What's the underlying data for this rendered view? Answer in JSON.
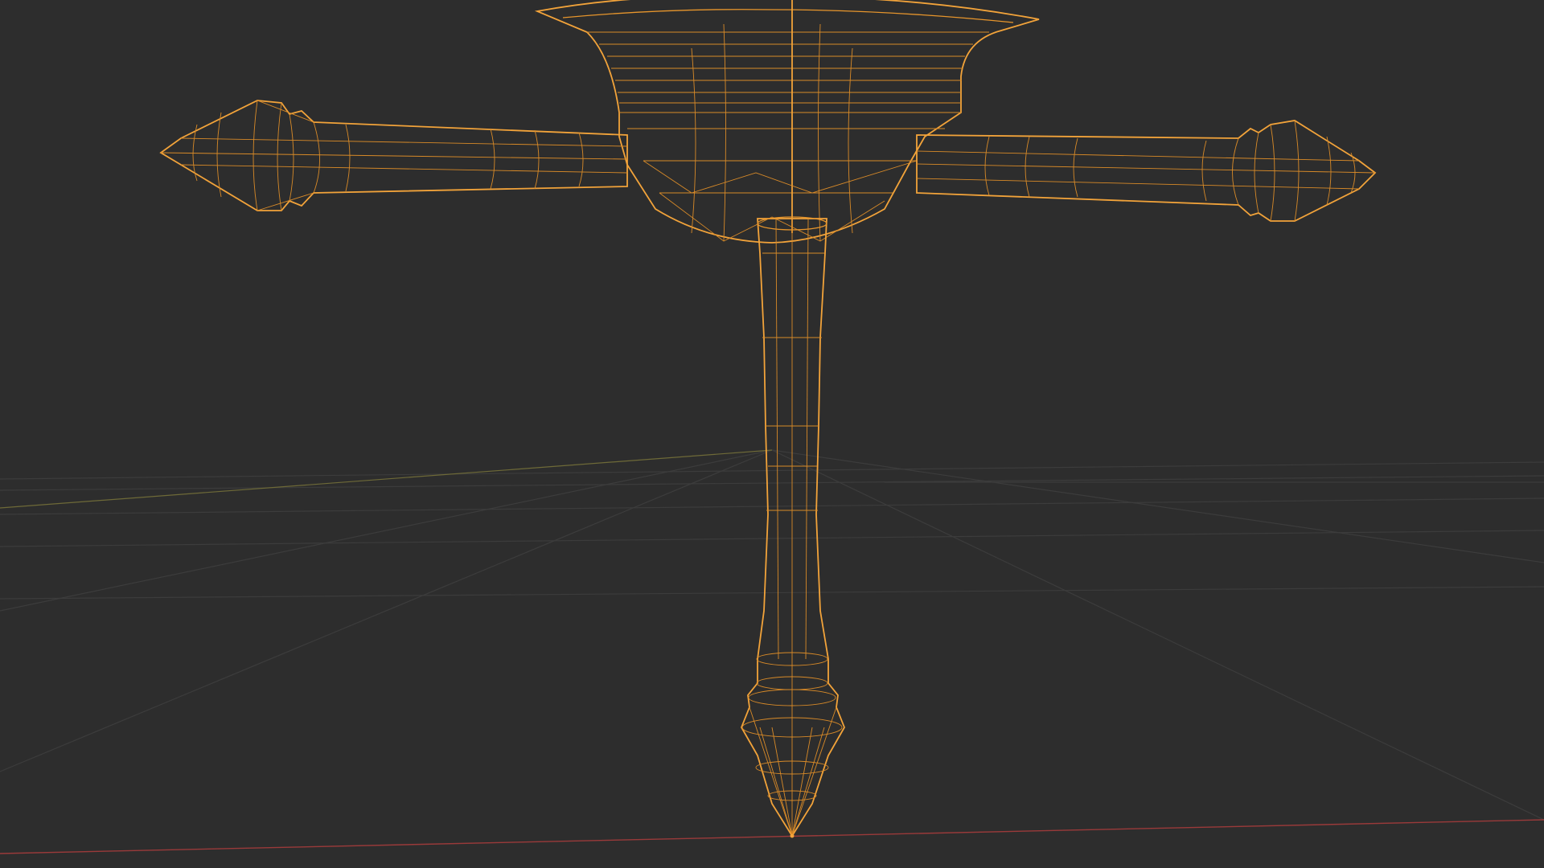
{
  "viewport": {
    "shading_mode": "wireframe",
    "background_color": "#2d2d2d",
    "grid_color": "#3c3c3c",
    "x_axis_color": "#9a3a3a",
    "y_axis_color": "#7a7a3a",
    "selection_wire_color": "#e8962c"
  },
  "object": {
    "name_visible": false,
    "selected": true,
    "description_icon": "mesh-object-icon"
  }
}
